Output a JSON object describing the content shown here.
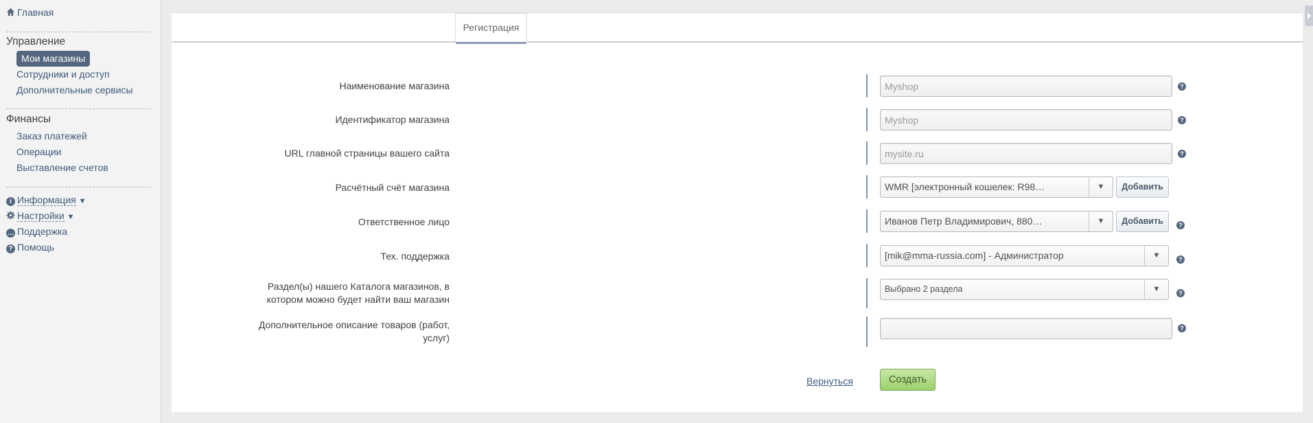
{
  "sidebar": {
    "home": "Главная",
    "sections": [
      {
        "title": "Управление",
        "items": [
          "Мои магазины",
          "Сотрудники и доступ",
          "Дополнительные сервисы"
        ]
      },
      {
        "title": "Финансы",
        "items": [
          "Заказ платежей",
          "Операции",
          "Выставление счетов"
        ]
      }
    ],
    "bottom": {
      "info": "Информация",
      "settings": "Настройки",
      "support": "Поддержка",
      "help": "Помощь",
      "caret": "▼"
    }
  },
  "tabs": [
    "Регистрация"
  ],
  "form": {
    "shop_name": {
      "label": "Наименование магазина",
      "placeholder": "Myshop"
    },
    "shop_id": {
      "label": "Идентификатор магазина",
      "placeholder": "Myshop"
    },
    "site_url": {
      "label": "URL главной страницы вашего сайта",
      "placeholder": "mysite.ru"
    },
    "account": {
      "label": "Расчётный счёт магазина",
      "value": "WMR [электронный кошелек: R98…",
      "add": "Добавить"
    },
    "person": {
      "label": "Ответственное лицо",
      "value": "Иванов Петр Владимирович, 880…",
      "add": "Добавить"
    },
    "support": {
      "label": "Тех. поддержка",
      "value": "[mik@mma-russia.com] - Администратор"
    },
    "catalog": {
      "label_line1": "Раздел(ы) нашего Каталога магазинов, в",
      "label_line2": "котором можно будет найти ваш магазин",
      "value": "Выбрано 2 раздела"
    },
    "description": {
      "label_line1": "Дополнительное описание товаров (работ,",
      "label_line2": "услуг)",
      "value": ""
    },
    "back": "Вернуться",
    "create": "Создать"
  },
  "icons": {
    "help": "?",
    "dropdown": "▼"
  },
  "colors": {
    "accent": "#54677e",
    "create_button": "#9bd06c",
    "link": "#3f5a7a"
  }
}
